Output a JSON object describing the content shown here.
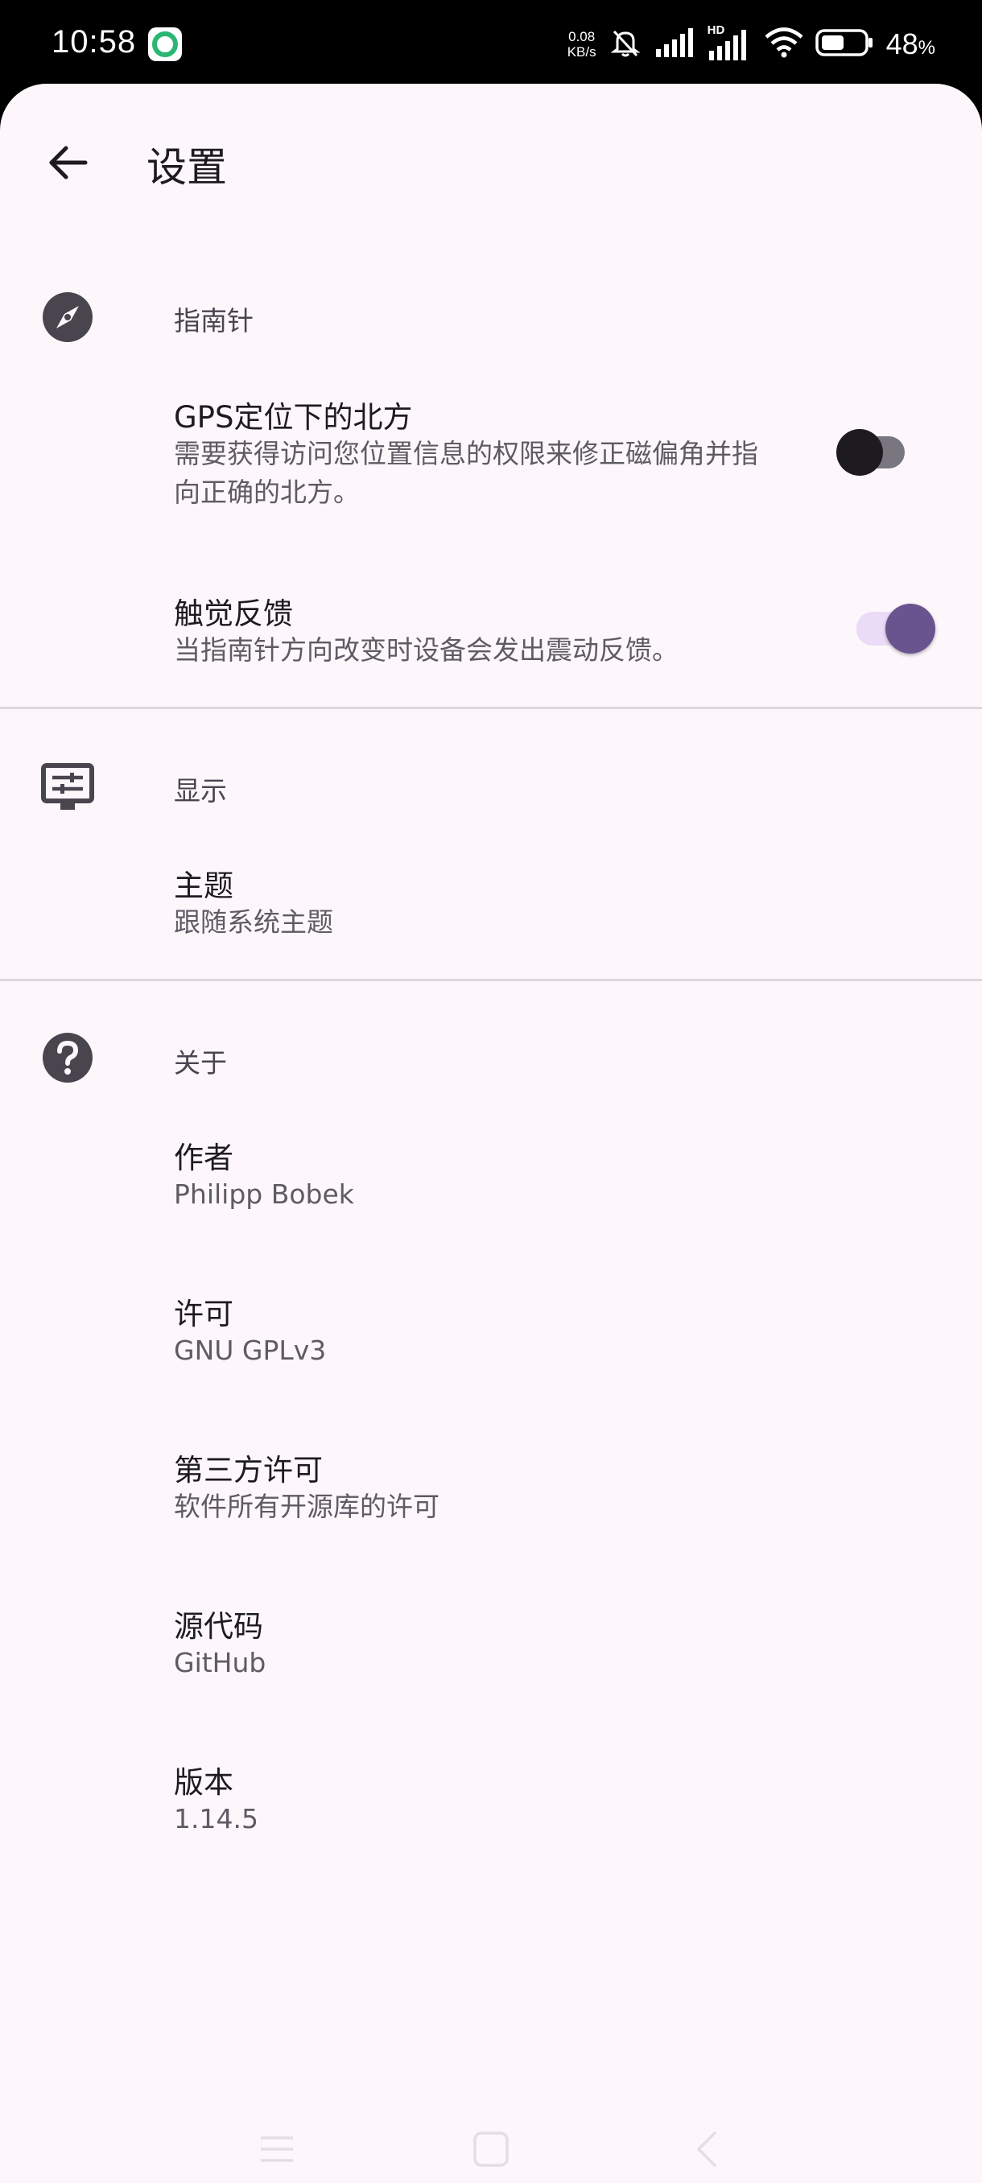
{
  "status_bar": {
    "time": "10:58",
    "net_speed_value": "0.08",
    "net_speed_unit": "KB/s",
    "hd_label": "HD",
    "battery_value": "48",
    "battery_unit": "%"
  },
  "app_bar": {
    "title": "设置"
  },
  "sections": {
    "compass": {
      "title": "指南针",
      "gps_north": {
        "title": "GPS定位下的北方",
        "summary_line1": "需要获得访问您位置信息的权限来修正磁偏角并指",
        "summary_line2": "向正确的北方。",
        "enabled": false
      },
      "haptic": {
        "title": "触觉反馈",
        "summary": "当指南针方向改变时设备会发出震动反馈。",
        "enabled": true
      }
    },
    "display": {
      "title": "显示",
      "theme": {
        "title": "主题",
        "summary": "跟随系统主题"
      }
    },
    "about": {
      "title": "关于",
      "author": {
        "title": "作者",
        "summary": "Philipp Bobek"
      },
      "license": {
        "title": "许可",
        "summary": "GNU GPLv3"
      },
      "third_party": {
        "title": "第三方许可",
        "summary": "软件所有开源库的许可"
      },
      "source": {
        "title": "源代码",
        "summary": "GitHub"
      },
      "version": {
        "title": "版本",
        "summary": "1.14.5"
      }
    }
  },
  "colors": {
    "background": "#fdf7fc",
    "accent": "#6a548f",
    "accent_track": "#eadcf6",
    "switch_off_thumb": "#1d1b20",
    "switch_off_track": "#7a7680",
    "icon": "#49454f"
  },
  "icons": {
    "back": "arrow-left-icon",
    "compass": "compass-icon",
    "display": "display-settings-icon",
    "about": "help-icon",
    "nav_menu": "menu-icon",
    "nav_home": "home-square-icon",
    "nav_back": "back-chevron-icon"
  }
}
